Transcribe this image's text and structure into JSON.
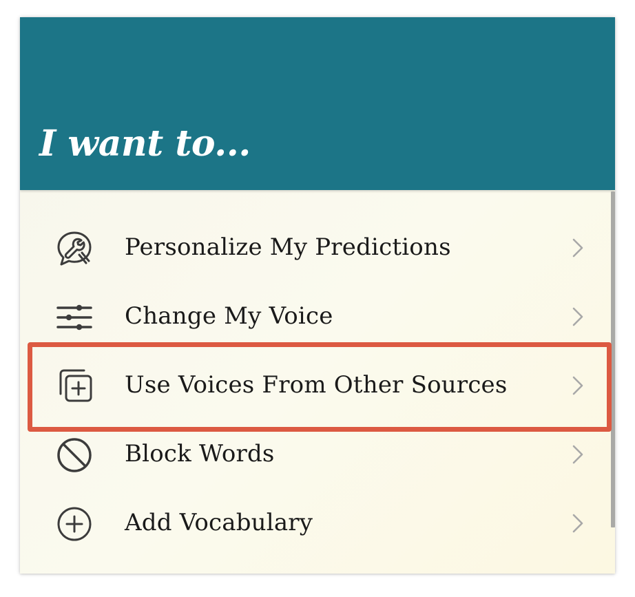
{
  "header": {
    "title": "I want to..."
  },
  "menu": {
    "items": [
      {
        "label": "Personalize My Predictions",
        "icon": "chat-wrench-icon"
      },
      {
        "label": "Change My Voice",
        "icon": "sliders-icon"
      },
      {
        "label": "Use Voices From Other Sources",
        "icon": "add-copy-icon",
        "highlighted": true
      },
      {
        "label": "Block Words",
        "icon": "block-icon"
      },
      {
        "label": "Add Vocabulary",
        "icon": "plus-circle-icon"
      }
    ]
  },
  "colors": {
    "header_background": "#1c7587",
    "highlight_border": "#dc5a42",
    "icon_color": "#3c3c3c",
    "chevron_color": "#a8a8a8"
  }
}
